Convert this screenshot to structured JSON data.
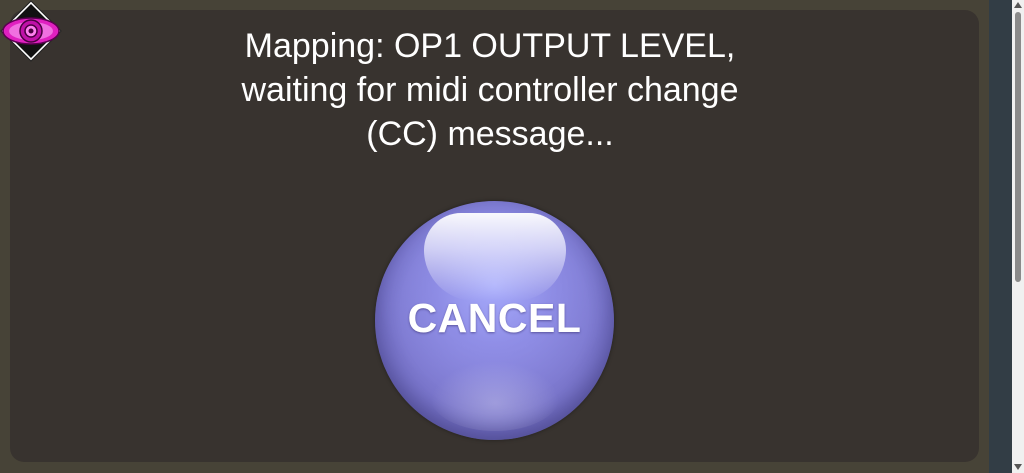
{
  "dialog": {
    "message_lines": [
      "Mapping: OP1 OUTPUT LEVEL,",
      "waiting for midi controller change",
      "(CC) message..."
    ],
    "cancel_label": "CANCEL"
  },
  "icons": {
    "logo": "eye-logo-icon",
    "scroll_up": "scroll-up-arrow-icon",
    "scroll_down": "scroll-down-arrow-icon"
  },
  "colors": {
    "background": "#474337",
    "panel": "#38332f",
    "button": "#7d79cf",
    "logo_accent": "#e020c0",
    "scrollbar": "#323d45"
  }
}
